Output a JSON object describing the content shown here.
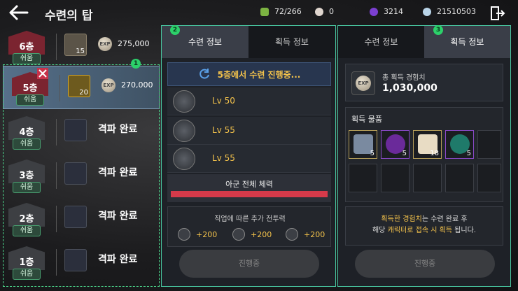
{
  "header": {
    "title": "수련의 탑",
    "resources": [
      {
        "icon": "stamina-icon",
        "value": "72/266",
        "color": "#7cb342"
      },
      {
        "icon": "pearl-icon",
        "value": "0",
        "color": "#e0d6cf"
      },
      {
        "icon": "purple-gem-icon",
        "value": "3214",
        "color": "#7b3fd1"
      },
      {
        "icon": "silver-coin-icon",
        "value": "21510503",
        "color": "#b9d4e8"
      }
    ]
  },
  "floors": [
    {
      "label": "6층",
      "difficulty": "쉬움",
      "item_count": "15",
      "exp_icon": "EXP",
      "exp": "275,000",
      "state": "locked"
    },
    {
      "label": "5층",
      "difficulty": "쉬움",
      "item_count": "20",
      "exp_icon": "EXP",
      "exp": "270,000",
      "state": "selected"
    },
    {
      "label": "4층",
      "difficulty": "쉬움",
      "status": "격파 완료",
      "state": "cleared"
    },
    {
      "label": "3층",
      "difficulty": "쉬움",
      "status": "격파 완료",
      "state": "cleared"
    },
    {
      "label": "2층",
      "difficulty": "쉬움",
      "status": "격파 완료",
      "state": "cleared"
    },
    {
      "label": "1층",
      "difficulty": "쉬움",
      "status": "격파 완료",
      "state": "cleared"
    }
  ],
  "callouts": [
    "1",
    "2",
    "3"
  ],
  "left_panel": {
    "tabs": [
      "수련 정보",
      "획득 정보"
    ],
    "progress_text": "5층에서 수련 진행중...",
    "skills": [
      {
        "icon": "sword-emblem-icon",
        "level": "Lv 50"
      },
      {
        "icon": "star-emblem-icon",
        "level": "Lv 55"
      },
      {
        "icon": "rose-emblem-icon",
        "level": "Lv 55"
      }
    ],
    "hp_label": "아군 전체 체력",
    "hp_fraction": 1.0,
    "bonus_title": "직업에 따른 추가 전투력",
    "bonuses": [
      "+200",
      "+200",
      "+200"
    ],
    "button": "진행중"
  },
  "right_panel": {
    "tabs": [
      "수련 정보",
      "획득 정보"
    ],
    "total_exp_icon": "EXP",
    "total_exp_label": "총 획득 경험치",
    "total_exp_value": "1,030,000",
    "loot_title": "획득 물품",
    "loot": [
      {
        "icon": "feather-item-icon",
        "count": "5"
      },
      {
        "icon": "purple-rune-icon",
        "count": "5"
      },
      {
        "icon": "scroll-item-icon",
        "count": "18"
      },
      {
        "icon": "green-rune-icon",
        "count": "5"
      }
    ],
    "note_line1_a": "획득한 경험치",
    "note_line1_b": "는 수련 완료 후",
    "note_line2_a": "해당 ",
    "note_line2_b": "캐릭터로 접속 시 획득",
    "note_line2_c": " 됩니다.",
    "button": "진행중"
  }
}
